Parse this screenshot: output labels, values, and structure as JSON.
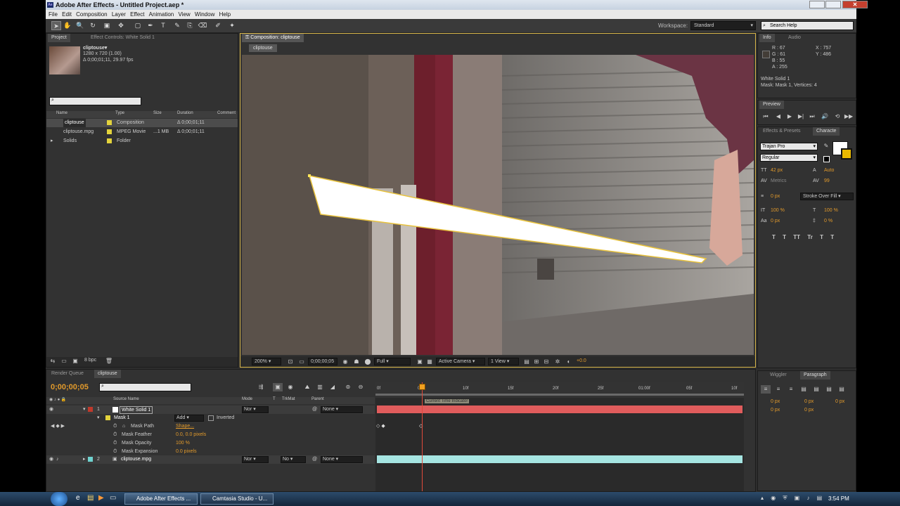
{
  "window": {
    "title": "Adobe After Effects - Untitled Project.aep *",
    "icon": "Ae"
  },
  "menu": [
    "File",
    "Edit",
    "Composition",
    "Layer",
    "Effect",
    "Animation",
    "View",
    "Window",
    "Help"
  ],
  "workspace": {
    "label": "Workspace:",
    "value": "Standard"
  },
  "search_help": "Search Help",
  "project": {
    "tabs": [
      "Project",
      "Effect Controls: White Solid 1"
    ],
    "item_name": "cliptouse▾",
    "item_res": "1280 x 720 (1.00)",
    "item_dur": "Δ 0;00;01;11, 29.97 fps",
    "columns": [
      "Name",
      "Type",
      "Size",
      "Duration",
      "Comment"
    ],
    "rows": [
      {
        "name": "cliptouse",
        "type": "Composition",
        "size": "",
        "duration": "Δ 0;00;01;11",
        "color": "#e3d33c"
      },
      {
        "name": "cliptouse.mpg",
        "type": "MPEG Movie",
        "size": "...1 MB",
        "duration": "Δ 0;00;01;11",
        "color": "#e3d33c"
      },
      {
        "name": "Solids",
        "type": "Folder",
        "size": "",
        "duration": "",
        "color": "#e3d33c"
      }
    ],
    "bpc": "8 bpc"
  },
  "composition": {
    "tab": "Composition: cliptouse",
    "subtab": "cliptouse",
    "zoom": "200%",
    "time": "0;00;00;05",
    "res": "Full",
    "camera": "Active Camera",
    "view": "1 View",
    "exposure": "+0.0"
  },
  "info": {
    "tabs": [
      "Info",
      "Audio"
    ],
    "r": "R : 67",
    "g": "G : 61",
    "b": "B : 55",
    "a": "A : 255",
    "x": "X : 757",
    "y": "Y : 486",
    "layer": "White Solid 1",
    "mask": "Mask: Mask 1, Vertices: 4"
  },
  "preview": {
    "title": "Preview"
  },
  "character": {
    "tabs": [
      "Effects & Presets",
      "Characte"
    ],
    "font": "Trajan Pro",
    "style": "Regular",
    "size": "42 px",
    "leading": "Auto",
    "tracking_label": "Metrics",
    "tracking": "99",
    "stroke_w": "0 px",
    "stroke_mode": "Stroke Over Fill",
    "vscale": "100 %",
    "hscale": "100 %",
    "baseline": "0 px",
    "tsume": "0 %",
    "tt": [
      "T",
      "T",
      "TT",
      "Tr",
      "T",
      "T"
    ]
  },
  "paragraph": {
    "tabs": [
      "Wiggler",
      "Paragraph"
    ],
    "indent": [
      "0 px",
      "0 px",
      "0 px",
      "0 px",
      "0 px"
    ]
  },
  "timeline": {
    "tabs": [
      "Render Queue",
      "cliptouse"
    ],
    "current_time": "0;00;00;05",
    "ruler": [
      "0f",
      "05f",
      "10f",
      "15f",
      "20f",
      "25f",
      "01:00f",
      "05f",
      "10f"
    ],
    "cols": [
      "Source Name",
      "Mode",
      "T",
      "TrkMat",
      "Parent"
    ],
    "tooltip": "Current Time Indicator",
    "layers": [
      {
        "num": "1",
        "name": "White Solid 1",
        "mode": "Nor",
        "trkmat": "",
        "parent": "None",
        "color": "#c0392b"
      },
      {
        "num": "2",
        "name": "cliptouse.mpg",
        "mode": "Nor",
        "trkmat": "No",
        "parent": "None",
        "color": "#6fd3d0"
      }
    ],
    "mask": {
      "name": "Mask 1",
      "mode": "Add",
      "inverted": "Inverted",
      "props": [
        {
          "name": "Mask Path",
          "value": "Shape..."
        },
        {
          "name": "Mask Feather",
          "value": "0.0, 0.0 pixels"
        },
        {
          "name": "Mask Opacity",
          "value": "100 %"
        },
        {
          "name": "Mask Expansion",
          "value": "0.0 pixels"
        }
      ]
    }
  },
  "taskbar": {
    "items": [
      "Adobe After Effects ...",
      "Camtasia Studio - U..."
    ],
    "clock": "3:54 PM"
  }
}
